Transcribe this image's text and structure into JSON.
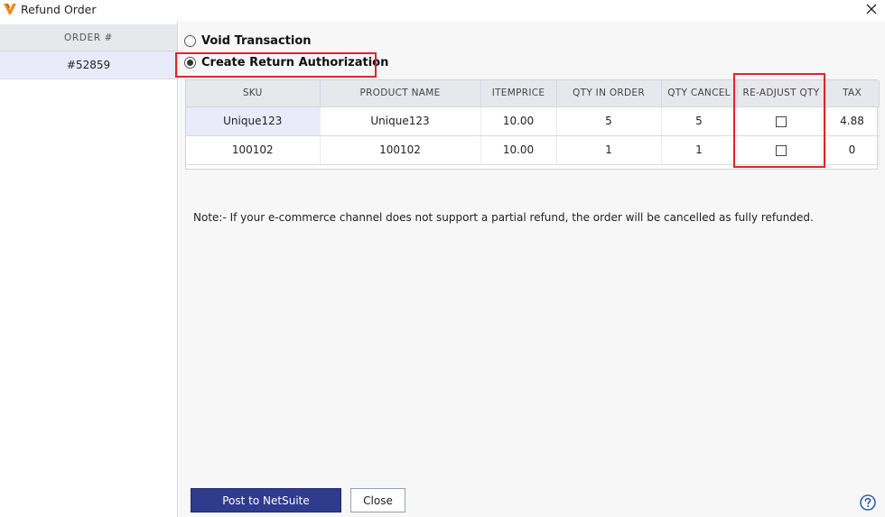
{
  "window": {
    "title": "Refund Order"
  },
  "sidebar": {
    "header": "ORDER #",
    "items": [
      {
        "label": "#52859",
        "selected": true
      }
    ]
  },
  "options": [
    {
      "label": "Void Transaction",
      "checked": false
    },
    {
      "label": "Create Return Authorization",
      "checked": true
    }
  ],
  "table": {
    "columns": [
      "SKU",
      "PRODUCT NAME",
      "ITEMPRICE",
      "QTY IN ORDER",
      "QTY CANCEL",
      "RE-ADJUST QTY",
      "TAX"
    ],
    "rows": [
      {
        "sku": "Unique123",
        "product_name": "Unique123",
        "itemprice": "10.00",
        "qty_in_order": "5",
        "qty_cancel": "5",
        "readjust": false,
        "tax": "4.88"
      },
      {
        "sku": "100102",
        "product_name": "100102",
        "itemprice": "10.00",
        "qty_in_order": "1",
        "qty_cancel": "1",
        "readjust": false,
        "tax": "0"
      }
    ]
  },
  "note": "Note:- If your e-commerce channel does not support a partial refund, the order will be cancelled as fully refunded.",
  "buttons": {
    "primary": "Post to NetSuite",
    "secondary": "Close"
  },
  "icons": {
    "logo": "app-logo-icon",
    "close": "close-icon",
    "help": "help-icon"
  },
  "colors": {
    "accent": "#2f3b8c",
    "highlight": "#e0242a",
    "selected_row": "#e9ebfb",
    "logo": "#f08a1c"
  }
}
